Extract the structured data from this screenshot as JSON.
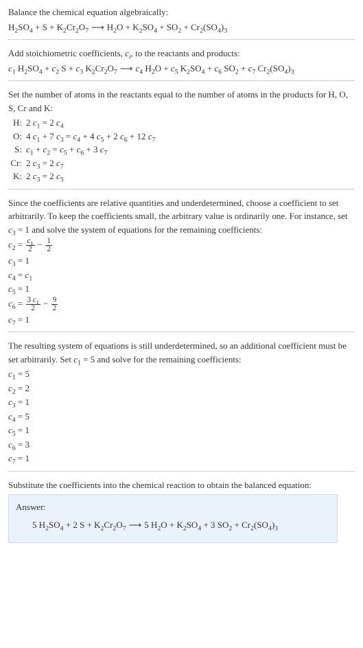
{
  "intro": {
    "line1": "Balance the chemical equation algebraically:"
  },
  "eq1": {
    "reactants": "H₂SO₄ + S + K₂Cr₂O₇",
    "products": "H₂O + K₂SO₄ + SO₂ + Cr₂(SO₄)₃"
  },
  "stoich": {
    "text": "Add stoichiometric coefficients, cᵢ, to the reactants and products:"
  },
  "atoms": {
    "text": "Set the number of atoms in the reactants equal to the number of atoms in the products for H, O, S, Cr and K:",
    "rows": [
      {
        "label": "H:",
        "eq": "2 c₁ = 2 c₄"
      },
      {
        "label": "O:",
        "eq": "4 c₁ + 7 c₃ = c₄ + 4 c₅ + 2 c₆ + 12 c₇"
      },
      {
        "label": "S:",
        "eq": "c₁ + c₂ = c₅ + c₆ + 3 c₇"
      },
      {
        "label": "Cr:",
        "eq": "2 c₃ = 2 c₇"
      },
      {
        "label": "K:",
        "eq": "2 c₃ = 2 c₅"
      }
    ]
  },
  "underdet1": {
    "text": "Since the coefficients are relative quantities and underdetermined, choose a coefficient to set arbitrarily. To keep the coefficients small, the arbitrary value is ordinarily one. For instance, set c₃ = 1 and solve the system of equations for the remaining coefficients:"
  },
  "coeffs1": {
    "c3": "c₃ = 1",
    "c4": "c₄ = c₁",
    "c5": "c₅ = 1",
    "c7": "c₇ = 1"
  },
  "underdet2": {
    "text": "The resulting system of equations is still underdetermined, so an additional coefficient must be set arbitrarily. Set c₁ = 5 and solve for the remaining coefficients:",
    "rows": [
      "c₁ = 5",
      "c₂ = 2",
      "c₃ = 1",
      "c₄ = 5",
      "c₅ = 1",
      "c₆ = 3",
      "c₇ = 1"
    ]
  },
  "final": {
    "text": "Substitute the coefficients into the chemical reaction to obtain the balanced equation:"
  },
  "answer": {
    "label": "Answer:"
  }
}
